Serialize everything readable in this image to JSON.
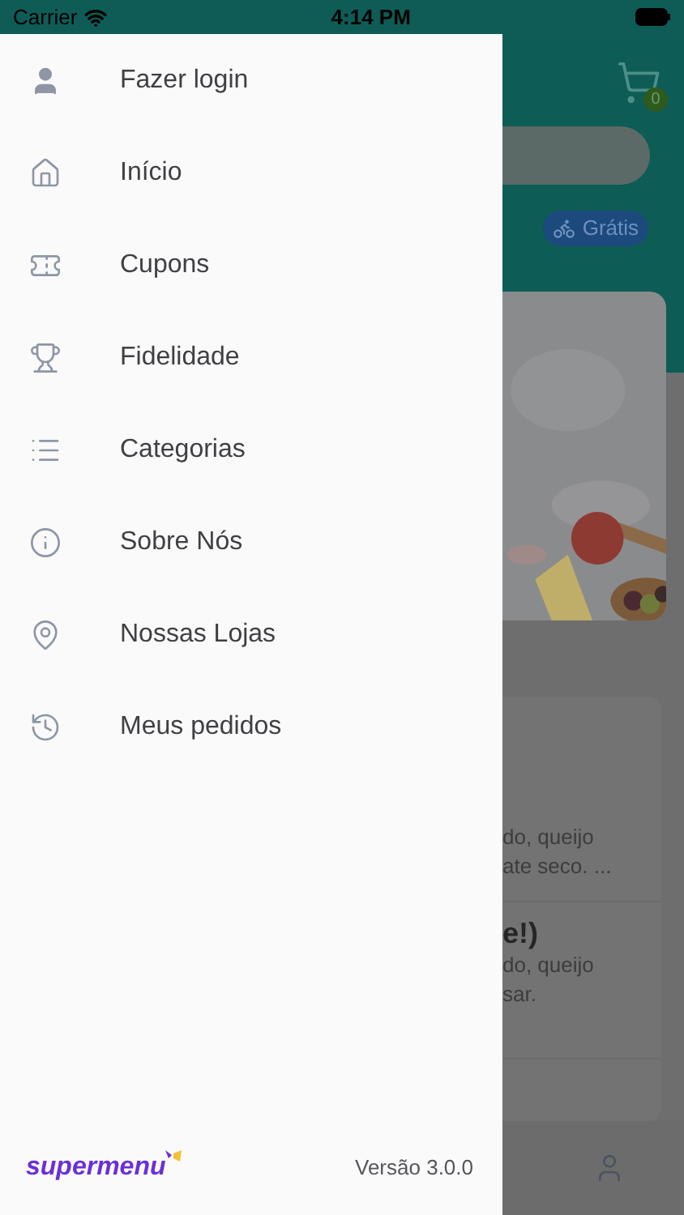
{
  "status_bar": {
    "carrier": "Carrier",
    "time": "4:14 PM"
  },
  "drawer": {
    "items": [
      {
        "label": "Fazer login"
      },
      {
        "label": "Início"
      },
      {
        "label": "Cupons"
      },
      {
        "label": "Fidelidade"
      },
      {
        "label": "Categorias"
      },
      {
        "label": "Sobre Nós"
      },
      {
        "label": "Nossas Lojas"
      },
      {
        "label": "Meus pedidos"
      }
    ],
    "footer": {
      "logo": "supermenu",
      "version": "Versão 3.0.0"
    }
  },
  "background": {
    "cart_count": "0",
    "delivery_badge": "Grátis",
    "cards": [
      {
        "lines": [
          "do, queijo",
          "ate seco. ..."
        ]
      },
      {
        "title": "e!)",
        "lines": [
          "do, queijo",
          "sar."
        ]
      }
    ]
  }
}
